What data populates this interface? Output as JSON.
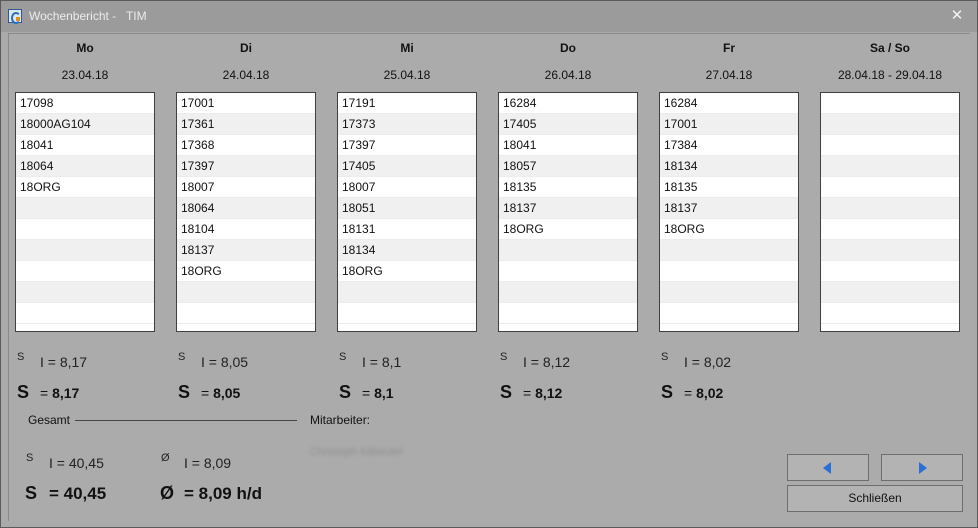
{
  "window": {
    "title": "Wochenbericht -   TIM",
    "close_glyph": "✕"
  },
  "days": [
    {
      "name": "Mo",
      "date": "23.04.18",
      "items": [
        "17098",
        "18000AG104",
        "18041",
        "18064",
        "18ORG"
      ],
      "sum_small_symbol": "S",
      "sum_small": "I = 8,17",
      "sum_big_symbol": "S",
      "sum_big_eq": "= ",
      "sum_big": "8,17"
    },
    {
      "name": "Di",
      "date": "24.04.18",
      "items": [
        "17001",
        "17361",
        "17368",
        "17397",
        "18007",
        "18064",
        "18104",
        "18137",
        "18ORG"
      ],
      "sum_small_symbol": "S",
      "sum_small": "I = 8,05",
      "sum_big_symbol": "S",
      "sum_big_eq": "= ",
      "sum_big": "8,05"
    },
    {
      "name": "Mi",
      "date": "25.04.18",
      "items": [
        "17191",
        "17373",
        "17397",
        "17405",
        "18007",
        "18051",
        "18131",
        "18134",
        "18ORG"
      ],
      "sum_small_symbol": "S",
      "sum_small": "I = 8,1",
      "sum_big_symbol": "S",
      "sum_big_eq": "= ",
      "sum_big": "8,1"
    },
    {
      "name": "Do",
      "date": "26.04.18",
      "items": [
        "16284",
        "17405",
        "18041",
        "18057",
        "18135",
        "18137",
        "18ORG"
      ],
      "sum_small_symbol": "S",
      "sum_small": "I = 8,12",
      "sum_big_symbol": "S",
      "sum_big_eq": "= ",
      "sum_big": "8,12"
    },
    {
      "name": "Fr",
      "date": "27.04.18",
      "items": [
        "16284",
        "17001",
        "17384",
        "18134",
        "18135",
        "18137",
        "18ORG"
      ],
      "sum_small_symbol": "S",
      "sum_small": "I = 8,02",
      "sum_big_symbol": "S",
      "sum_big_eq": "= ",
      "sum_big": "8,02"
    },
    {
      "name": "Sa / So",
      "date": "28.04.18 - 29.04.18",
      "items": []
    }
  ],
  "totals": {
    "gesamt_label": "Gesamt",
    "mitarbeiter_label": "Mitarbeiter:",
    "mitarbeiter_name": "Christoph Kilbeutel",
    "sum_small_symbol": "S",
    "sum_small": "I = 40,45",
    "avg_small_symbol": "Ø",
    "avg_small": "I = 8,09",
    "sum_big_symbol": "S",
    "sum_big": "= 40,45",
    "avg_big_symbol": "Ø",
    "avg_big": "= 8,09 h/d"
  },
  "buttons": {
    "close_label": "Schließen"
  },
  "colors": {
    "accent_arrow": "#2a6fd6"
  }
}
